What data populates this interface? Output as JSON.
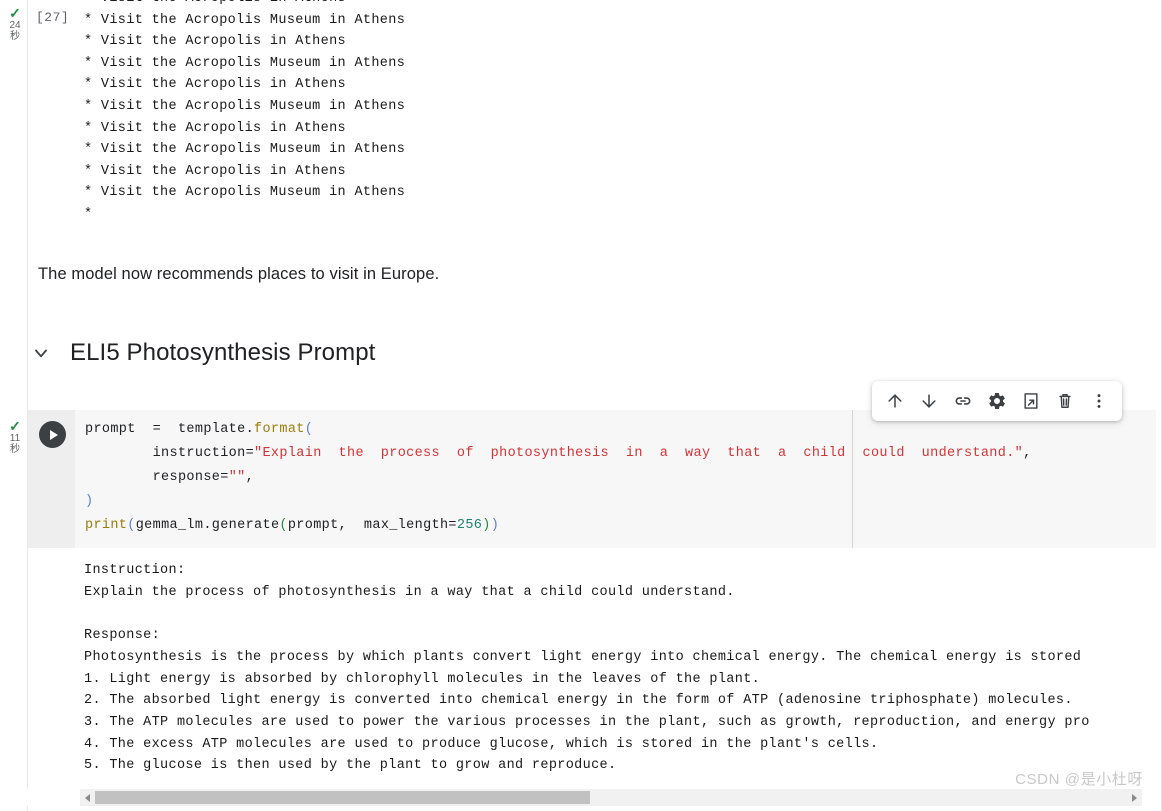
{
  "notebook": {
    "cell_1": {
      "exec_check": "✓",
      "exec_time_number": "24",
      "exec_time_unit": "秒",
      "exec_label": "[27]",
      "output": "* Visit the Acropolis in Athens\n* Visit the Acropolis Museum in Athens\n* Visit the Acropolis in Athens\n* Visit the Acropolis Museum in Athens\n* Visit the Acropolis in Athens\n* Visit the Acropolis Museum in Athens\n* Visit the Acropolis in Athens\n* Visit the Acropolis Museum in Athens\n* Visit the Acropolis in Athens\n* Visit the Acropolis Museum in Athens\n*"
    },
    "markdown_paragraph": "The model now recommends places to visit in Europe.",
    "section": {
      "chevron_icon": "chevron-down-icon",
      "title": "ELI5 Photosynthesis Prompt"
    },
    "cell_2": {
      "exec_check": "✓",
      "exec_time_number": "11",
      "exec_time_unit": "秒",
      "run_icon": "play-icon",
      "code": {
        "line1_a": "prompt  =  template.",
        "line1_func": "format",
        "line1_paren": "(",
        "line2_a": "        instruction=",
        "line2_str": "\"Explain  the  process  of  photosynthesis  in  a  way  that  a  child  could  understand.\"",
        "line2_b": ",",
        "line3_a": "        response=",
        "line3_str": "\"\"",
        "line3_b": ",",
        "line4_paren": ")",
        "line5_func": "print",
        "line5_paren_open": "(",
        "line5_a": "gemma_lm.generate",
        "line5_paren_open2": "(",
        "line5_b": "prompt,  max_length=",
        "line5_num": "256",
        "line5_paren_close": ")",
        "line5_paren_close2": ")"
      },
      "output": "Instruction:\nExplain the process of photosynthesis in a way that a child could understand.\n\nResponse:\nPhotosynthesis is the process by which plants convert light energy into chemical energy. The chemical energy is stored\n1. Light energy is absorbed by chlorophyll molecules in the leaves of the plant.\n2. The absorbed light energy is converted into chemical energy in the form of ATP (adenosine triphosphate) molecules.\n3. The ATP molecules are used to power the various processes in the plant, such as growth, reproduction, and energy pro\n4. The excess ATP molecules are used to produce glucose, which is stored in the plant's cells.\n5. The glucose is then used by the plant to grow and reproduce."
    },
    "toolbar": {
      "buttons": [
        {
          "name": "move-cell-up-button",
          "icon": "arrow-up-icon",
          "label": "Move cell up"
        },
        {
          "name": "move-cell-down-button",
          "icon": "arrow-down-icon",
          "label": "Move cell down"
        },
        {
          "name": "link-to-cell-button",
          "icon": "link-icon",
          "label": "Link to cell"
        },
        {
          "name": "cell-settings-button",
          "icon": "gear-icon",
          "label": "Cell settings"
        },
        {
          "name": "copy-to-drive-button",
          "icon": "copy-to-drive-icon",
          "label": "Copy to Drive"
        },
        {
          "name": "delete-cell-button",
          "icon": "trash-icon",
          "label": "Delete cell"
        },
        {
          "name": "more-options-button",
          "icon": "more-vertical-icon",
          "label": "More cell actions"
        }
      ]
    },
    "scrollbar": {
      "left_arrow_icon": "caret-left-icon",
      "right_arrow_icon": "caret-right-icon"
    }
  },
  "watermark": "CSDN @是小杜呀",
  "colors": {
    "accent_green": "#1e8e3e",
    "code_bg": "#f7f7f7",
    "gutter_bg": "#eeeeee",
    "string": "#d13438",
    "function": "#9a7d0a",
    "number": "#1a8570",
    "paren_blue": "#5b7fd4"
  }
}
